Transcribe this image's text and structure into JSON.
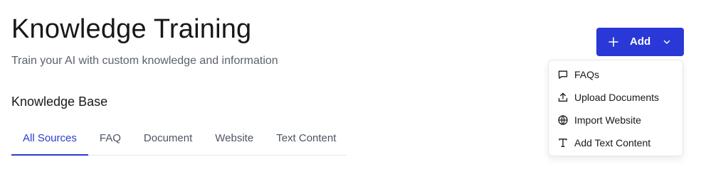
{
  "header": {
    "title": "Knowledge Training",
    "subtitle": "Train your AI with custom knowledge and information"
  },
  "add_button": {
    "label": "Add",
    "icon": "plus-icon",
    "dropdown_icon": "chevron-down-icon",
    "color": "#2938d6"
  },
  "knowledge_base": {
    "title": "Knowledge Base",
    "tabs": [
      {
        "label": "All Sources",
        "active": true
      },
      {
        "label": "FAQ",
        "active": false
      },
      {
        "label": "Document",
        "active": false
      },
      {
        "label": "Website",
        "active": false
      },
      {
        "label": "Text Content",
        "active": false
      }
    ]
  },
  "add_menu": {
    "items": [
      {
        "label": "FAQs",
        "icon": "message-square-icon"
      },
      {
        "label": "Upload Documents",
        "icon": "upload-icon"
      },
      {
        "label": "Import Website",
        "icon": "globe-icon"
      },
      {
        "label": "Add Text Content",
        "icon": "text-type-icon"
      }
    ]
  },
  "colors": {
    "accent": "#2b3bd0",
    "text": "#18181b",
    "muted": "#5b6170"
  }
}
